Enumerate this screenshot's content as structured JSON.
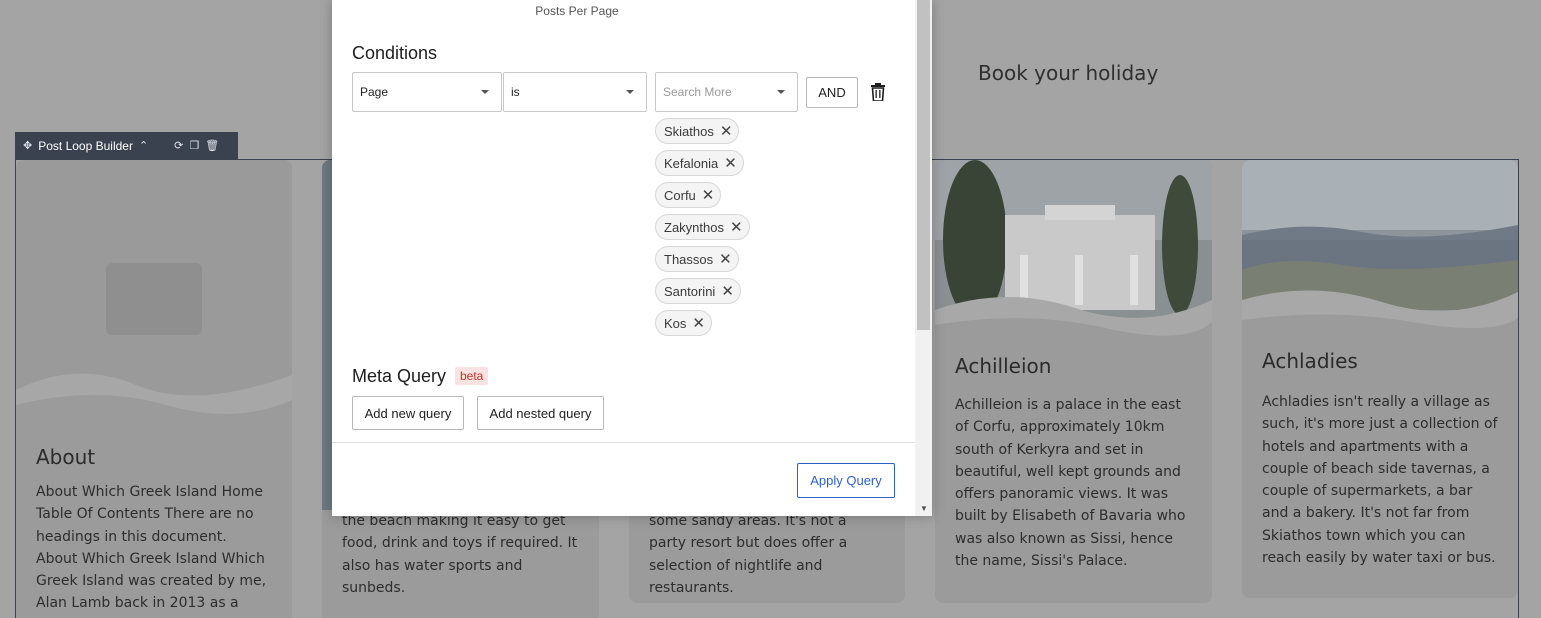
{
  "background": {
    "heading": "Book your holiday",
    "toolbar": {
      "label": "Post Loop Builder"
    },
    "cards": [
      {
        "title": "About",
        "body": "About Which Greek Island Home Table Of Contents There are no headings in this document. About Which Greek Island Which Greek Island was created by me, Alan Lamb back in 2013 as a"
      },
      {
        "title": "",
        "body": "the beach making it easy to get food, drink and toys if required. It also has water sports and sunbeds."
      },
      {
        "title": "",
        "body": "some sandy areas. It's not a party resort but does offer a selection of nightlife and restaurants."
      },
      {
        "title": "Achilleion",
        "body": "Achilleion is a palace in the east of Corfu, approximately 10km south of Kerkyra and set in beautiful, well kept grounds and offers panoramic views. It was built by Elisabeth of Bavaria who was also known as Sissi, hence the name, Sissi's Palace."
      },
      {
        "title": "Achladies",
        "body": "Achladies isn't really a village as such, it's more just a collection of hotels and apartments with a couple of beach side tavernas, a couple of supermarkets, a bar and a bakery. It's not far from Skiathos town which you can reach easily by water taxi or bus."
      }
    ]
  },
  "modal": {
    "posts_per_page_label": "Posts Per Page",
    "conditions_title": "Conditions",
    "condition": {
      "field": "Page",
      "operator": "is",
      "search_placeholder": "Search More",
      "logic_button": "AND",
      "selected": [
        "Skiathos",
        "Kefalonia",
        "Corfu",
        "Zakynthos",
        "Thassos",
        "Santorini",
        "Kos"
      ]
    },
    "meta_query_title": "Meta Query",
    "beta_badge": "beta",
    "add_query_button": "Add new query",
    "add_nested_button": "Add nested query",
    "apply_button": "Apply Query"
  },
  "colors": {
    "accent": "#2e5fc9",
    "beta_bg": "#fde2e2",
    "beta_text": "#c53030",
    "toolbar_bg": "#3a4250"
  }
}
